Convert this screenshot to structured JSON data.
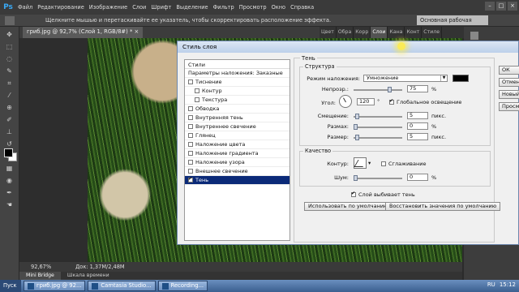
{
  "app": {
    "logo": "Ps",
    "menu": [
      "Файл",
      "Редактирование",
      "Изображение",
      "Слои",
      "Шрифт",
      "Выделение",
      "Фильтр",
      "Просмотр",
      "Окно",
      "Справка"
    ],
    "hint": "Щелкните мышью и перетаскивайте ее указатель, чтобы скорректировать расположение эффекта.",
    "workspace": "Основная рабочая среда",
    "window_buttons": [
      "–",
      "□",
      "×"
    ]
  },
  "document": {
    "tab_label": "гриб.jpg @ 92,7% (Слой 1, RGB/8#) *",
    "close": "×"
  },
  "panel_tabs": [
    "Цвет",
    "Обра",
    "Корр",
    "Слои",
    "Кана",
    "Конт",
    "Стиле"
  ],
  "status": {
    "zoom": "92,67%",
    "doc": "Док: 1,37M/2,48M"
  },
  "bottom_tabs": [
    "Mini Bridge",
    "Шкала времени"
  ],
  "taskbar": {
    "start": "Пуск",
    "tasks": [
      "гриб.jpg @ 92...",
      "Camtasia Studio...",
      "Recording..."
    ],
    "lang": "RU",
    "time": "15:12"
  },
  "dialog": {
    "title": "Стиль слоя",
    "list_header": "Стили",
    "items": [
      {
        "label": "Параметры наложения: Заказные",
        "checkbox": false,
        "indent": false,
        "checked": false,
        "selected": false
      },
      {
        "label": "Тиснение",
        "checkbox": true,
        "indent": false,
        "checked": false,
        "selected": false
      },
      {
        "label": "Контур",
        "checkbox": true,
        "indent": true,
        "checked": false,
        "selected": false
      },
      {
        "label": "Текстура",
        "checkbox": true,
        "indent": true,
        "checked": false,
        "selected": false
      },
      {
        "label": "Обводка",
        "checkbox": true,
        "indent": false,
        "checked": false,
        "selected": false
      },
      {
        "label": "Внутренняя тень",
        "checkbox": true,
        "indent": false,
        "checked": false,
        "selected": false
      },
      {
        "label": "Внутреннее свечение",
        "checkbox": true,
        "indent": false,
        "checked": false,
        "selected": false
      },
      {
        "label": "Глянец",
        "checkbox": true,
        "indent": false,
        "checked": false,
        "selected": false
      },
      {
        "label": "Наложение цвета",
        "checkbox": true,
        "indent": false,
        "checked": false,
        "selected": false
      },
      {
        "label": "Наложение градиента",
        "checkbox": true,
        "indent": false,
        "checked": false,
        "selected": false
      },
      {
        "label": "Наложение узора",
        "checkbox": true,
        "indent": false,
        "checked": false,
        "selected": false
      },
      {
        "label": "Внешнее свечение",
        "checkbox": true,
        "indent": false,
        "checked": false,
        "selected": false
      },
      {
        "label": "Тень",
        "checkbox": true,
        "indent": false,
        "checked": true,
        "selected": true
      }
    ],
    "section_title": "Тень",
    "structure": {
      "title": "Структура",
      "blend_label": "Режим наложения:",
      "blend_value": "Умножение",
      "shadow_color": "#000000",
      "opacity_label": "Непрозр.:",
      "opacity_value": "75",
      "angle_label": "Угол:",
      "angle_value": "120",
      "angle_unit": "°",
      "global_light_label": "Глобальное освещение",
      "global_light_checked": true,
      "distance_label": "Смещение:",
      "distance_value": "5",
      "spread_label": "Размах:",
      "spread_value": "0",
      "size_label": "Размер:",
      "size_value": "5",
      "unit_px": "пикс.",
      "unit_pct": "%"
    },
    "quality": {
      "title": "Качество",
      "contour_label": "Контур:",
      "antialias_label": "Сглаживание",
      "antialias_checked": false,
      "noise_label": "Шум:",
      "noise_value": "0",
      "unit_pct": "%"
    },
    "knockout_label": "Слой выбивает тень",
    "knockout_checked": true,
    "default_button": "Использовать по умолчанию",
    "reset_button": "Восстановить значения по умолчанию",
    "right_buttons": [
      "ОК",
      "Отмена",
      "Новый стиль...",
      "Просмотр"
    ]
  }
}
